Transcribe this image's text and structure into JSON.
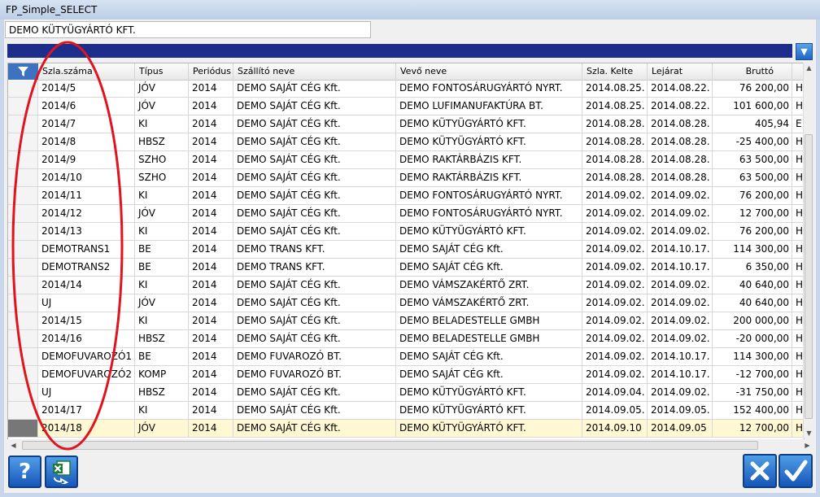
{
  "window": {
    "title": "FP_Simple_SELECT"
  },
  "company": {
    "value": "DEMO KÜTYÜGYÁRTÓ KFT."
  },
  "grid": {
    "columns": [
      {
        "key": "szla",
        "label": "Szla.száma"
      },
      {
        "key": "tipus",
        "label": "Típus"
      },
      {
        "key": "periodus",
        "label": "Periódus"
      },
      {
        "key": "szallito",
        "label": "Szállító neve"
      },
      {
        "key": "vevo",
        "label": "Vevő neve"
      },
      {
        "key": "kelte",
        "label": "Szla. Kelte"
      },
      {
        "key": "lejarat",
        "label": "Lejárat"
      },
      {
        "key": "brutto",
        "label": "Bruttó"
      },
      {
        "key": "extra",
        "label": ""
      }
    ],
    "rows": [
      {
        "szla": "2014/5",
        "tipus": "JÓV",
        "periodus": "2014",
        "szallito": "DEMO SAJÁT CÉG Kft.",
        "vevo": "DEMO FONTOSÁRUGYÁRTÓ NYRT.",
        "kelte": "2014.08.25.",
        "lejarat": "2014.08.22.",
        "brutto": "76 200,00",
        "extra": "H"
      },
      {
        "szla": "2014/6",
        "tipus": "JÓV",
        "periodus": "2014",
        "szallito": "DEMO SAJÁT CÉG Kft.",
        "vevo": "DEMO LUFIMANUFAKTÚRA BT.",
        "kelte": "2014.08.25.",
        "lejarat": "2014.08.22.",
        "brutto": "101 600,00",
        "extra": "H"
      },
      {
        "szla": "2014/7",
        "tipus": "KI",
        "periodus": "2014",
        "szallito": "DEMO SAJÁT CÉG Kft.",
        "vevo": "DEMO KÜTYÜGYÁRTÓ KFT.",
        "kelte": "2014.08.28.",
        "lejarat": "2014.08.28.",
        "brutto": "405,94",
        "extra": "E"
      },
      {
        "szla": "2014/8",
        "tipus": "HBSZ",
        "periodus": "2014",
        "szallito": "DEMO SAJÁT CÉG Kft.",
        "vevo": "DEMO KÜTYÜGYÁRTÓ KFT.",
        "kelte": "2014.08.28.",
        "lejarat": "2014.08.28.",
        "brutto": "-25 400,00",
        "extra": "H"
      },
      {
        "szla": "2014/9",
        "tipus": "SZHO",
        "periodus": "2014",
        "szallito": "DEMO SAJÁT CÉG Kft.",
        "vevo": "DEMO RAKTÁRBÁZIS KFT.",
        "kelte": "2014.08.28.",
        "lejarat": "2014.08.28.",
        "brutto": "63 500,00",
        "extra": "H"
      },
      {
        "szla": "2014/10",
        "tipus": "SZHO",
        "periodus": "2014",
        "szallito": "DEMO SAJÁT CÉG Kft.",
        "vevo": "DEMO RAKTÁRBÁZIS KFT.",
        "kelte": "2014.08.28.",
        "lejarat": "2014.08.28.",
        "brutto": "63 500,00",
        "extra": "H"
      },
      {
        "szla": "2014/11",
        "tipus": "KI",
        "periodus": "2014",
        "szallito": "DEMO SAJÁT CÉG Kft.",
        "vevo": "DEMO FONTOSÁRUGYÁRTÓ NYRT.",
        "kelte": "2014.09.02.",
        "lejarat": "2014.09.02.",
        "brutto": "76 200,00",
        "extra": "H"
      },
      {
        "szla": "2014/12",
        "tipus": "JÓV",
        "periodus": "2014",
        "szallito": "DEMO SAJÁT CÉG Kft.",
        "vevo": "DEMO FONTOSÁRUGYÁRTÓ NYRT.",
        "kelte": "2014.09.02.",
        "lejarat": "2014.09.02.",
        "brutto": "12 700,00",
        "extra": "H"
      },
      {
        "szla": "2014/13",
        "tipus": "KI",
        "periodus": "2014",
        "szallito": "DEMO SAJÁT CÉG Kft.",
        "vevo": "DEMO KÜTYÜGYÁRTÓ KFT.",
        "kelte": "2014.09.02.",
        "lejarat": "2014.09.02.",
        "brutto": "76 200,00",
        "extra": "H"
      },
      {
        "szla": "DEMOTRANS1",
        "tipus": "BE",
        "periodus": "2014",
        "szallito": "DEMO TRANS KFT.",
        "vevo": "DEMO SAJÁT CÉG Kft.",
        "kelte": "2014.09.02.",
        "lejarat": "2014.10.17.",
        "brutto": "114 300,00",
        "extra": "H"
      },
      {
        "szla": "DEMOTRANS2",
        "tipus": "BE",
        "periodus": "2014",
        "szallito": "DEMO TRANS KFT.",
        "vevo": "DEMO SAJÁT CÉG Kft.",
        "kelte": "2014.09.02.",
        "lejarat": "2014.10.17.",
        "brutto": "6 350,00",
        "extra": "H"
      },
      {
        "szla": "2014/14",
        "tipus": "KI",
        "periodus": "2014",
        "szallito": "DEMO SAJÁT CÉG Kft.",
        "vevo": "DEMO VÁMSZAKÉRTŐ ZRT.",
        "kelte": "2014.09.02.",
        "lejarat": "2014.09.02.",
        "brutto": "40 640,00",
        "extra": "H"
      },
      {
        "szla": "UJ",
        "tipus": "JÓV",
        "periodus": "2014",
        "szallito": "DEMO SAJÁT CÉG Kft.",
        "vevo": "DEMO VÁMSZAKÉRTŐ ZRT.",
        "kelte": "2014.09.02.",
        "lejarat": "2014.09.02.",
        "brutto": "40 640,00",
        "extra": "H"
      },
      {
        "szla": "2014/15",
        "tipus": "KI",
        "periodus": "2014",
        "szallito": "DEMO SAJÁT CÉG Kft.",
        "vevo": "DEMO BELADESTELLE GMBH",
        "kelte": "2014.09.02.",
        "lejarat": "2014.09.02.",
        "brutto": "200 000,00",
        "extra": "H"
      },
      {
        "szla": "2014/16",
        "tipus": "HBSZ",
        "periodus": "2014",
        "szallito": "DEMO SAJÁT CÉG Kft.",
        "vevo": "DEMO BELADESTELLE GMBH",
        "kelte": "2014.09.02.",
        "lejarat": "2014.09.02.",
        "brutto": "-20 000,00",
        "extra": "H"
      },
      {
        "szla": "DEMOFUVAROZÓ1",
        "tipus": "BE",
        "periodus": "2014",
        "szallito": "DEMO FUVAROZÓ BT.",
        "vevo": "DEMO SAJÁT CÉG Kft.",
        "kelte": "2014.09.02.",
        "lejarat": "2014.10.17.",
        "brutto": "114 300,00",
        "extra": "H"
      },
      {
        "szla": "DEMOFUVAROZÓ2",
        "tipus": "KOMP",
        "periodus": "2014",
        "szallito": "DEMO FUVAROZÓ BT.",
        "vevo": "DEMO SAJÁT CÉG Kft.",
        "kelte": "2014.09.02.",
        "lejarat": "2014.10.17.",
        "brutto": "-12 700,00",
        "extra": "H"
      },
      {
        "szla": "UJ",
        "tipus": "HBSZ",
        "periodus": "2014",
        "szallito": "DEMO SAJÁT CÉG Kft.",
        "vevo": "DEMO KÜTYÜGYÁRTÓ KFT.",
        "kelte": "2014.09.04.",
        "lejarat": "2014.09.02.",
        "brutto": "-31 750,00",
        "extra": "H"
      },
      {
        "szla": "2014/17",
        "tipus": "KI",
        "periodus": "2014",
        "szallito": "DEMO SAJÁT CÉG Kft.",
        "vevo": "DEMO KÜTYÜGYÁRTÓ KFT.",
        "kelte": "2014.09.05.",
        "lejarat": "2014.09.05.",
        "brutto": "152 400,00",
        "extra": "H"
      },
      {
        "szla": "2014/18",
        "tipus": "JÓV",
        "periodus": "2014",
        "szallito": "DEMO SAJÁT CÉG Kft.",
        "vevo": "DEMO KÜTYÜGYÁRTÓ KFT.",
        "kelte": "2014.09.10",
        "lejarat": "2014.09.05",
        "brutto": "12 700,00",
        "extra": "H",
        "selected": true
      }
    ]
  },
  "footer": {
    "help_label": "?",
    "icons": [
      "help-icon",
      "excel-export-icon",
      "cancel-icon",
      "confirm-icon"
    ]
  },
  "colors": {
    "header_bar": "#1c2d8c",
    "button": "#1f65c4",
    "selected_row": "#fff8d2",
    "annotation": "#e0141e"
  }
}
